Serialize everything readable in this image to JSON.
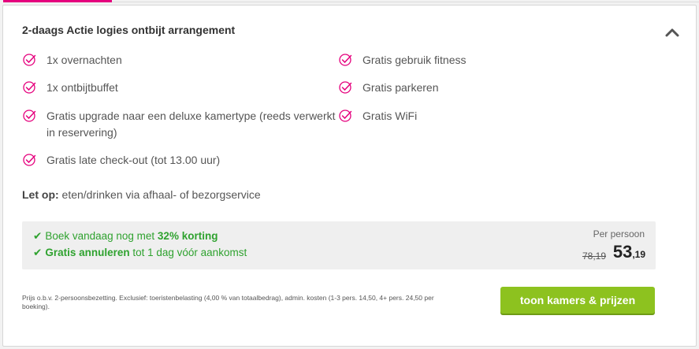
{
  "colors": {
    "accent": "#e5007d",
    "green": "#2fa22f",
    "cta": "#8dc21f"
  },
  "package": {
    "title": "2-daags Actie logies ontbijt arrangement",
    "features_left": [
      "1x overnachten",
      "1x ontbijtbuffet",
      "Gratis upgrade naar een deluxe kamertype (reeds verwerkt in reservering)",
      "Gratis late check-out (tot 13.00 uur)"
    ],
    "features_right": [
      "Gratis gebruik fitness",
      "Gratis parkeren",
      "Gratis WiFi"
    ],
    "note_label": "Let op:",
    "note_text": " eten/drinken via afhaal- of bezorgservice"
  },
  "promo": {
    "line1_prefix": "Boek vandaag nog met ",
    "line1_bold": "32% korting",
    "line2_bold": "Gratis annuleren",
    "line2_suffix": " tot 1 dag vóór aankomst",
    "per_person_label": "Per persoon",
    "old_price": "78,19",
    "price_whole": "53",
    "price_cents": ",19"
  },
  "footer": {
    "fine_print": "Prijs o.b.v. 2-persoonsbezetting. Exclusief: toeristenbelasting (4,00 % van totaalbedrag), admin. kosten (1-3 pers. 14,50, 4+ pers. 24,50 per boeking).",
    "cta_label": "toon kamers & prijzen"
  }
}
